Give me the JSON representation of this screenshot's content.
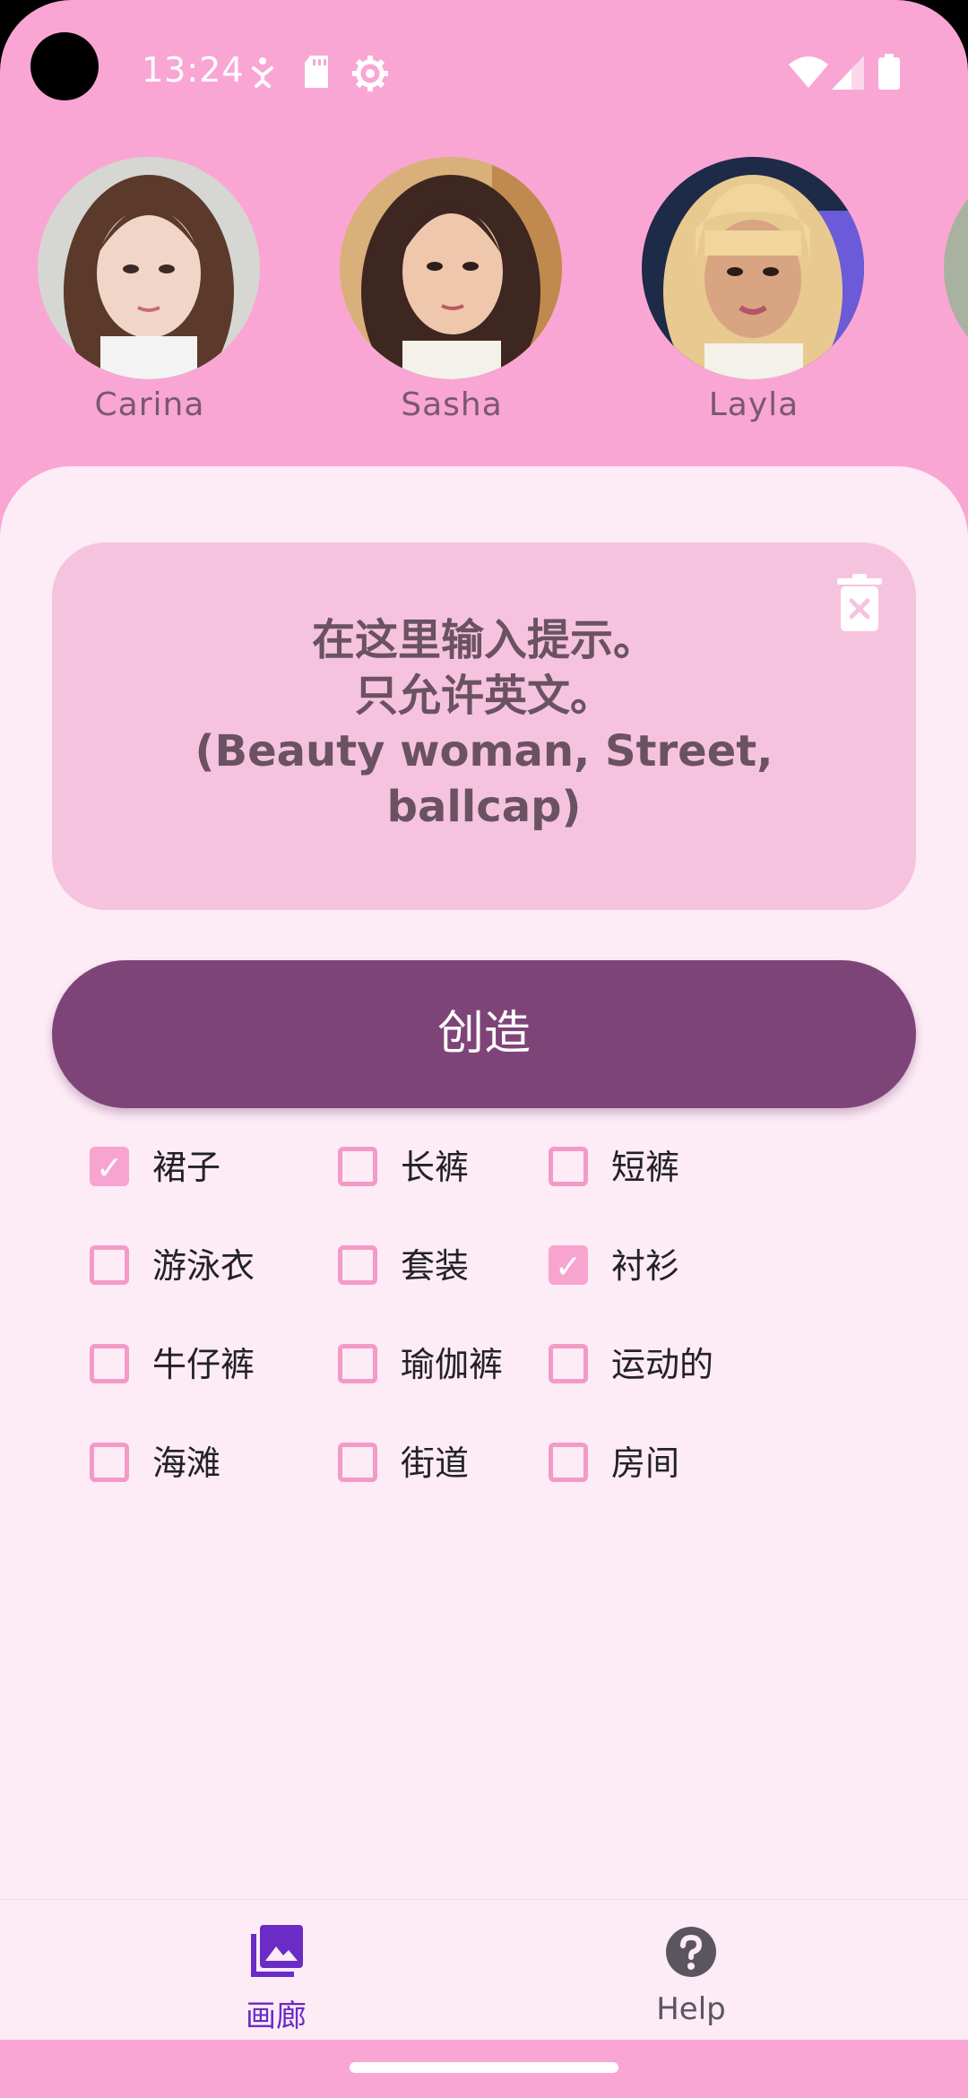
{
  "status_bar": {
    "time": "13:24",
    "left_icons": [
      "accessibility-icon",
      "sd-card-icon",
      "settings-icon"
    ],
    "right_icons": [
      "wifi-icon",
      "signal-icon",
      "battery-icon"
    ]
  },
  "avatars": [
    {
      "name": "Carina"
    },
    {
      "name": "Sasha"
    },
    {
      "name": "Layla"
    }
  ],
  "prompt": {
    "line1": "在这里输入提示。",
    "line2": "只允许英文。",
    "line3": "(Beauty woman, Street,",
    "line4": "ballcap)"
  },
  "create_button": {
    "label": "创造"
  },
  "options": [
    {
      "label": "裙子",
      "checked": true
    },
    {
      "label": "长裤",
      "checked": false
    },
    {
      "label": "短裤",
      "checked": false
    },
    {
      "label": "游泳衣",
      "checked": false
    },
    {
      "label": "套装",
      "checked": false
    },
    {
      "label": "衬衫",
      "checked": true
    },
    {
      "label": "牛仔裤",
      "checked": false
    },
    {
      "label": "瑜伽裤",
      "checked": false
    },
    {
      "label": "运动的",
      "checked": false
    },
    {
      "label": "海滩",
      "checked": false
    },
    {
      "label": "街道",
      "checked": false
    },
    {
      "label": "房间",
      "checked": false
    }
  ],
  "bottom_nav": {
    "gallery_label": "画廊",
    "help_label": "Help"
  },
  "colors": {
    "header_pink": "#f9a6d4",
    "sheet": "#fdebf6",
    "prompt_box": "#f6c3de",
    "button": "#7e4478",
    "checkbox": "#f39ac8",
    "nav_active": "#6a2bc7"
  }
}
